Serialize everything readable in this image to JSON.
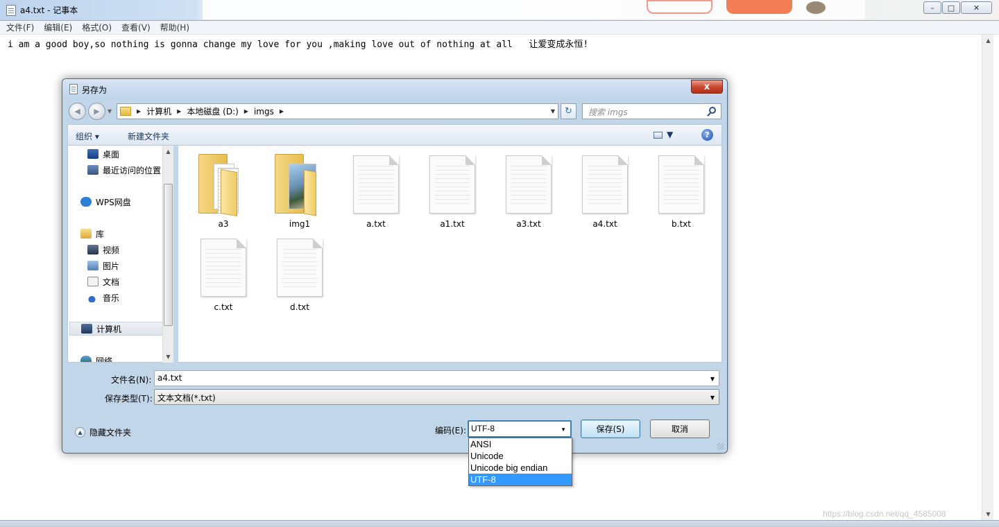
{
  "notepad": {
    "title": "a4.txt - 记事本",
    "menu": [
      "文件(F)",
      "编辑(E)",
      "格式(O)",
      "查看(V)",
      "帮助(H)"
    ],
    "content": "i am a good boy,so nothing is gonna change my love for you ,making love out of nothing at all   让爱变成永恒!"
  },
  "dialog": {
    "title": "另存为",
    "close_symbol": "x",
    "breadcrumb": [
      "计算机",
      "本地磁盘 (D:)",
      "imgs"
    ],
    "search_placeholder": "搜索 imgs",
    "toolbar": {
      "organize": "组织 ▾",
      "new_folder": "新建文件夹",
      "help": "?"
    },
    "nav_items": [
      {
        "label": "桌面",
        "icon": "desktop-icon"
      },
      {
        "label": "最近访问的位置",
        "icon": "recent-places-icon"
      },
      {
        "label": "WPS网盘",
        "icon": "cloud-drive-icon"
      },
      {
        "label": "库",
        "icon": "library-icon"
      },
      {
        "label": "视频",
        "icon": "video-icon"
      },
      {
        "label": "图片",
        "icon": "pictures-icon"
      },
      {
        "label": "文档",
        "icon": "documents-icon"
      },
      {
        "label": "音乐",
        "icon": "music-icon"
      },
      {
        "label": "计算机",
        "icon": "computer-icon"
      },
      {
        "label": "网络",
        "icon": "network-icon"
      }
    ],
    "files": [
      {
        "name": "a3",
        "kind": "folder"
      },
      {
        "name": "img1",
        "kind": "folder"
      },
      {
        "name": "a.txt",
        "kind": "text"
      },
      {
        "name": "a1.txt",
        "kind": "text"
      },
      {
        "name": "a3.txt",
        "kind": "text"
      },
      {
        "name": "a4.txt",
        "kind": "text"
      },
      {
        "name": "b.txt",
        "kind": "text"
      },
      {
        "name": "c.txt",
        "kind": "text"
      },
      {
        "name": "d.txt",
        "kind": "text"
      }
    ],
    "filename_label": "文件名(N):",
    "filename_value": "a4.txt",
    "filetype_label": "保存类型(T):",
    "filetype_value": "文本文档(*.txt)",
    "hide_folders": "隐藏文件夹",
    "encoding_label": "编码(E):",
    "encoding_value": "UTF-8",
    "encoding_options": [
      "ANSI",
      "Unicode",
      "Unicode big endian",
      "UTF-8"
    ],
    "save_button": "保存(S)",
    "cancel_button": "取消"
  },
  "watermark": "https://blog.csdn.net/qq_4585008"
}
